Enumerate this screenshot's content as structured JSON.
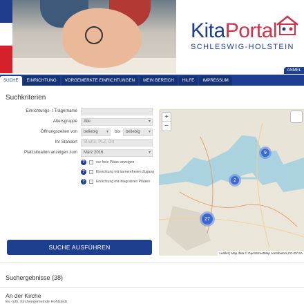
{
  "header": {
    "logo_kita": "Kita",
    "logo_portal": "Portal",
    "logo_sub": "SCHLESWIG-HOLSTEIN",
    "login_label": "ANMEL",
    "colors": {
      "brand_blue": "#1e3f8f",
      "brand_red": "#d0324a"
    }
  },
  "nav": {
    "tabs": [
      {
        "label": "SUCHE",
        "active": true
      },
      {
        "label": "EINRICHTUNG"
      },
      {
        "label": "VORGEMERKTE EINRICHTUNGEN"
      },
      {
        "label": "MEIN BEREICH"
      },
      {
        "label": "HILFE"
      },
      {
        "label": "IMPRESSUM"
      }
    ]
  },
  "search": {
    "title": "Suchkriterien",
    "fields": {
      "name_label": "Einrichtungs- / Trägername",
      "name_value": "",
      "age_label": "Altersgruppe",
      "age_value": "Alle",
      "hours_label": "Öffnungszeiten von",
      "hours_from": "beliebig",
      "hours_to_label": "bis",
      "hours_to": "beliebig",
      "location_label": "Ihr Standort",
      "location_placeholder": "Straße, PLZ, Ort",
      "places_label": "Platzsituation anzeigen zum",
      "places_value": "März 2016"
    },
    "checkboxes": [
      {
        "label": "nur freie Plätze anzeigen"
      },
      {
        "label": "Einrichtung mit barrierefreiem Zugang"
      },
      {
        "label": "Einrichtung mit integrativen Plätzen"
      }
    ],
    "button_label": "SUCHE AUSFÜHREN"
  },
  "map": {
    "zoom_in": "+",
    "zoom_out": "−",
    "clusters": [
      "9",
      "2",
      "27"
    ],
    "attribution": "Leaflet | Map data © OpenStreetMap contributors,CC-BY-SA"
  },
  "results": {
    "title": "Suchergebnisse (38)",
    "first_item_title": "An der Kirche",
    "first_item_sub": "Ev.-luth. Kirchengemeinde Hohlstedt"
  }
}
